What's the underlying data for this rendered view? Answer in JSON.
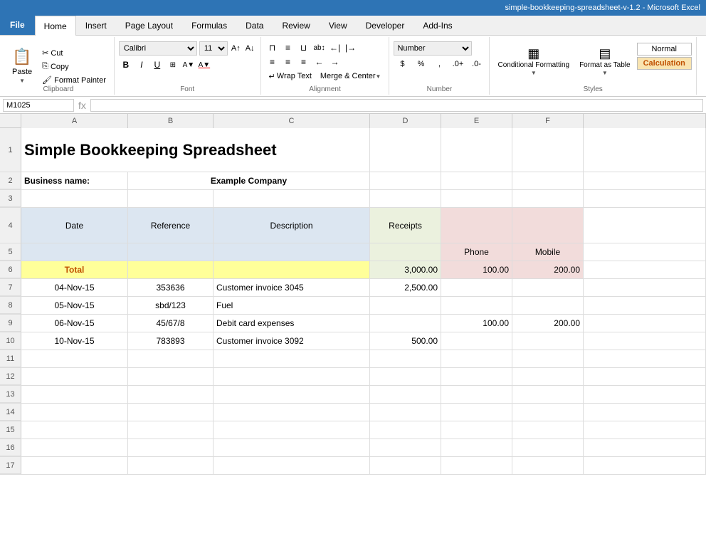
{
  "titleBar": {
    "text": "simple-bookkeeping-spreadsheet-v-1.2 - Microsoft Excel"
  },
  "ribbonTabs": {
    "tabs": [
      "File",
      "Home",
      "Insert",
      "Page Layout",
      "Formulas",
      "Data",
      "Review",
      "View",
      "Developer",
      "Add-Ins"
    ]
  },
  "clipboard": {
    "groupLabel": "Clipboard",
    "paste": "Paste",
    "cut": "Cut",
    "copy": "Copy",
    "formatPainter": "Format Painter"
  },
  "font": {
    "groupLabel": "Font",
    "fontName": "Calibri",
    "fontSize": "11",
    "bold": "B",
    "italic": "I",
    "underline": "U"
  },
  "alignment": {
    "groupLabel": "Alignment",
    "wrapText": "Wrap Text",
    "mergeCenter": "Merge & Center"
  },
  "numberGroup": {
    "groupLabel": "Number",
    "format": "Number"
  },
  "styles": {
    "groupLabel": "Styles",
    "conditionalFormatting": "Conditional Formatting",
    "formatAsTable": "Format as Table",
    "normal": "Normal",
    "calculation": "Calculation"
  },
  "formulaBar": {
    "cellRef": "M1025",
    "formula": ""
  },
  "columnHeaders": [
    "A",
    "B",
    "C",
    "D",
    "E",
    "F"
  ],
  "spreadsheet": {
    "title": "Simple Bookkeeping Spreadsheet",
    "businessLabel": "Business name:",
    "businessName": "Example Company",
    "headers": {
      "date": "Date",
      "reference": "Reference",
      "description": "Description",
      "receipts": "Receipts",
      "phone": "Phone",
      "mobile": "Mobile"
    },
    "totals": {
      "label": "Total",
      "receipts": "3,000.00",
      "phone": "100.00",
      "mobile": "200.00"
    },
    "rows": [
      {
        "rowNum": 7,
        "date": "04-Nov-15",
        "reference": "353636",
        "description": "Customer invoice 3045",
        "receipts": "2,500.00",
        "phone": "",
        "mobile": ""
      },
      {
        "rowNum": 8,
        "date": "05-Nov-15",
        "reference": "sbd/123",
        "description": "Fuel",
        "receipts": "",
        "phone": "",
        "mobile": ""
      },
      {
        "rowNum": 9,
        "date": "06-Nov-15",
        "reference": "45/67/8",
        "description": "Debit card expenses",
        "receipts": "",
        "phone": "100.00",
        "mobile": "200.00"
      },
      {
        "rowNum": 10,
        "date": "10-Nov-15",
        "reference": "783893",
        "description": "Customer invoice 3092",
        "receipts": "500.00",
        "phone": "",
        "mobile": ""
      }
    ],
    "emptyRows": [
      11,
      12,
      13,
      14,
      15,
      16,
      17
    ]
  }
}
